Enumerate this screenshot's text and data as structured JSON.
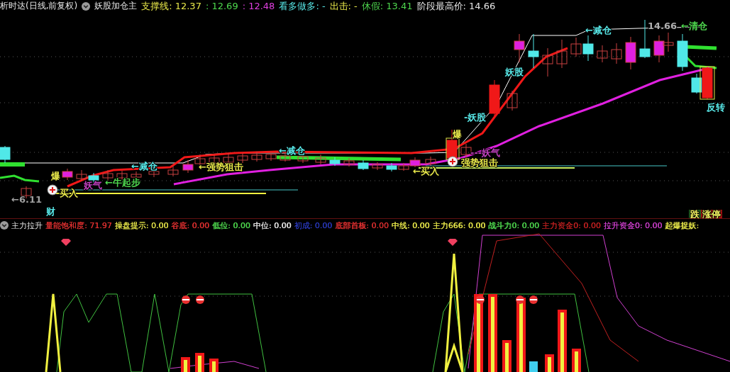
{
  "header": {
    "title": "析时达(日线,前复权)",
    "indicator": "妖股加仓主",
    "fields": [
      {
        "text": "支撑线: 12.37",
        "color": "#e8e84a"
      },
      {
        "text": ": 12.69",
        "color": "#4ed84e"
      },
      {
        "text": ": 12.48",
        "color": "#e040e0"
      },
      {
        "text": "看多做多: -",
        "color": "#58e8e8"
      },
      {
        "text": "出击: -",
        "color": "#e8e84a"
      },
      {
        "text": "休假: 13.41",
        "color": "#4ed84e"
      },
      {
        "text": "阶段最高价: 14.66",
        "color": "#e6e6e6"
      }
    ]
  },
  "main_chart": {
    "labels": [
      {
        "text": "←减仓",
        "color": "#58e8e8"
      },
      {
        "text": "←减仓",
        "color": "#58e8e8"
      },
      {
        "text": "←减仓",
        "color": "#58e8e8"
      },
      {
        "text": "14.66",
        "color": "#b0b0b0"
      },
      {
        "text": "←清仓",
        "color": "#4ed84e"
      },
      {
        "text": "妖股",
        "color": "#58e8e8"
      },
      {
        "text": "-妖股",
        "color": "#58e8e8"
      },
      {
        "text": "反转",
        "color": "#58e8e8"
      },
      {
        "text": "爆",
        "color": "#e8e84a"
      },
      {
        "text": "爆",
        "color": "#e8e84a"
      },
      {
        "text": "妖气",
        "color": "#c040c0"
      },
      {
        "text": "买入",
        "color": "#e8e84a"
      },
      {
        "text": "←牛起步",
        "color": "#4ed84e"
      },
      {
        "text": "←强势狙击",
        "color": "#e8e84a"
      },
      {
        "text": "←买入",
        "color": "#e8e84a"
      },
      {
        "text": "---妖气",
        "color": "#c040c0"
      },
      {
        "text": "强势狙击",
        "color": "#e8e84a"
      },
      {
        "text": "←6.11",
        "color": "#a0a0a0"
      },
      {
        "text": "财",
        "color": "#58e8e8"
      }
    ],
    "badges": [
      {
        "text": "跌",
        "color": "#1f5a1f"
      },
      {
        "text": "涨停",
        "color": "#a01010"
      }
    ]
  },
  "sub_chart": {
    "title": "主力拉升",
    "fields": [
      {
        "text": "量能饱和度: 71.97",
        "color": "#e03030"
      },
      {
        "text": "操盘提示: 0.00",
        "color": "#e8e84a"
      },
      {
        "text": "谷底: 0.00",
        "color": "#e03030"
      },
      {
        "text": "低位: 0.00",
        "color": "#4ed84e"
      },
      {
        "text": "中位: 0.00",
        "color": "#e6e6e6"
      },
      {
        "text": "初成: 0.00",
        "color": "#2a3ac0"
      },
      {
        "text": "底部首板: 0.00",
        "color": "#e03030"
      },
      {
        "text": "中线: 0.00",
        "color": "#e8e84a"
      },
      {
        "text": "主力666: 0.00",
        "color": "#e8e84a"
      },
      {
        "text": "战斗力0: 0.00",
        "color": "#4ed84e"
      },
      {
        "text": "主力资金0: 0.00",
        "color": "#c02020"
      },
      {
        "text": "拉升资金0: 0.00",
        "color": "#d040d0"
      },
      {
        "text": "起爆捉妖:",
        "color": "#e8e84a"
      }
    ]
  }
}
